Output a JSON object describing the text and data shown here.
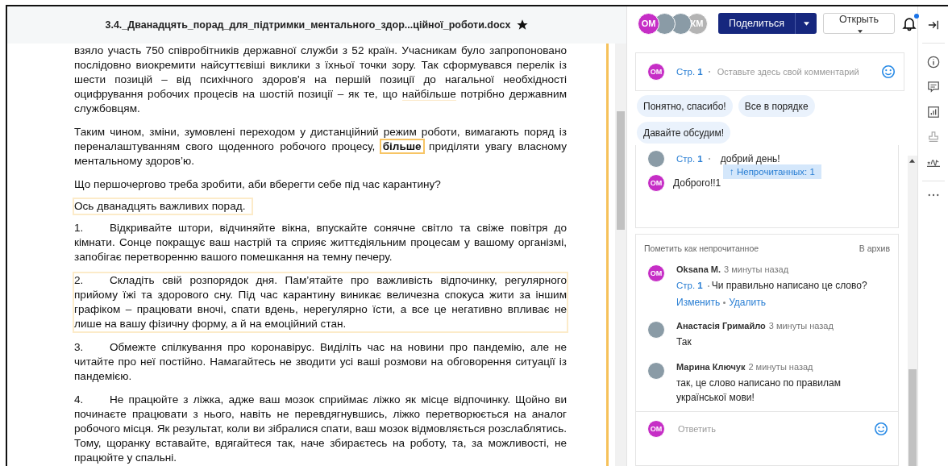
{
  "document": {
    "title": "3.4._Дванадцять_порад_для_підтримки_ментального_здор...ційної_роботи.docx",
    "starred": true,
    "paragraphs": [
      {
        "kind": "text",
        "highlighted": false,
        "segments": [
          {
            "text": "взяло участь 750 співробітників державної служби з 52 країн. Учасникам було запропоновано послідовно виокремити найсуттєвіші виклики з їхньої точки зору. Так сформувався перелік із шести позицій – від психічного здоров'я на першій позиції до нагальної необхідності оцифрування робочих процесів на шостій позиції – як те, що ",
            "kind": "plain"
          },
          {
            "text": "найбільше",
            "kind": "underlined"
          },
          {
            "text": " потрібно державним службовцям.",
            "kind": "plain"
          }
        ]
      },
      {
        "kind": "text",
        "highlighted": false,
        "segments": [
          {
            "text": "Таким чином, зміни, зумовлені переходом у дистанційний режим роботи, вимагають поряд із переналаштуванням свого щоденного робочого процесу, ",
            "kind": "plain"
          },
          {
            "text": "більше",
            "kind": "comment_anchor"
          },
          {
            "text": " приділяти увагу власному ментальному здоров’ю.",
            "kind": "plain"
          }
        ]
      },
      {
        "kind": "text",
        "highlighted": false,
        "segments": [
          {
            "text": "Що першочергово треба зробити, аби вберегти себе під час карантину?",
            "kind": "plain"
          }
        ]
      },
      {
        "kind": "text",
        "highlighted": true,
        "segments": [
          {
            "text": "Ось дванадцять важливих порад.",
            "kind": "plain"
          }
        ]
      },
      {
        "kind": "numbered",
        "number": "1.",
        "highlighted": false,
        "segments": [
          {
            "text": "Відкривайте штори, відчиняйте вікна, впускайте сонячне світло та свіже повітря до кімнати. Сонце покращує ваш настрій та сприяє життєдіяльним процесам у вашому організмі, запобігає перетворенню вашого помешкання на темну печеру.",
            "kind": "plain"
          }
        ]
      },
      {
        "kind": "numbered",
        "number": "2.",
        "highlighted": true,
        "segments": [
          {
            "text": "Складіть свій розпорядок дня. Пам’ятайте про важливість відпочинку, регулярного прийому їжі та здорового сну. Під час карантину виникає величезна спокуса жити за іншим графіком – працювати вночі, спати вдень, нерегулярно їсти, а все це негативно впливає не лише на вашу фізичну форму, а й на емоційний стан.",
            "kind": "plain"
          }
        ]
      },
      {
        "kind": "numbered",
        "number": "3.",
        "highlighted": false,
        "segments": [
          {
            "text": "Обмежте спілкування про коронавірус. Виділіть час на новини про пандемію, але не читайте про неї постійно. Намагайтесь не зводити усі ваші розмови на обговорення ситуації із пандемією.",
            "kind": "plain"
          }
        ]
      },
      {
        "kind": "numbered",
        "number": "4.",
        "highlighted": false,
        "segments": [
          {
            "text": "Не працюйте з ліжка, адже ваш мозок сприймає ліжко як місце відпочинку. Щойно ви починаєте працювати з нього, навіть не перевдягнувшись, ліжко перетворюється на аналог робочого місця. Як результат, коли ви зібралися спати, ваш мозок відмовляється розслаблятись. Тому, щоранку вставайте, вдягайтеся так, наче збираєтесь на роботу, та, за можливості, не працюйте у спальні.",
            "kind": "plain"
          }
        ]
      }
    ]
  },
  "header": {
    "avatars": [
      {
        "kind": "initials",
        "initials": "ОМ",
        "color": "#c62ec6"
      },
      {
        "kind": "photo"
      },
      {
        "kind": "photo"
      },
      {
        "kind": "initials",
        "initials": "КМ",
        "color": "#b4b4b4"
      }
    ],
    "share_button": "Поделиться",
    "open_button": "Открыть",
    "notifications_unread": true
  },
  "composer": {
    "avatar": "ОМ",
    "page": "Стр. **1**",
    "placeholder": "Оставьте здесь свой комментарий"
  },
  "quick_replies": [
    "Понятно, спасибо!",
    "Все в порядке",
    "Давайте обсудим!"
  ],
  "thread_1": {
    "messages": [
      {
        "kind": "photo_avatar",
        "page": "Стр. **1**",
        "text": "добрий день!"
      },
      {
        "kind": "initials_avatar",
        "avatar": "ОМ",
        "text": "Доброго!!1"
      }
    ],
    "unread_badge": "↑ Непрочитанных: 1"
  },
  "thread_2": {
    "mark_unread": "Пометить как непрочитанное",
    "archive": "В архив",
    "comments": [
      {
        "kind": "initials_avatar",
        "avatar": "ОМ",
        "author": "Oksana M.",
        "time": "3 минуты назад",
        "page": "Стр. **1**",
        "text": "Чи правильно  написано це слово?",
        "actions": [
          "Изменить",
          "Удалить"
        ]
      },
      {
        "kind": "photo_avatar",
        "author": "Анастасія Гримайло",
        "time": "3 минуты назад",
        "text": "Так"
      },
      {
        "kind": "photo_avatar",
        "author": "Марина Ключук",
        "time": "2 минуты назад",
        "text": "так, це слово написано по правилам української мови!"
      }
    ],
    "reply_avatar": "ОМ",
    "reply_placeholder": "Ответить"
  }
}
